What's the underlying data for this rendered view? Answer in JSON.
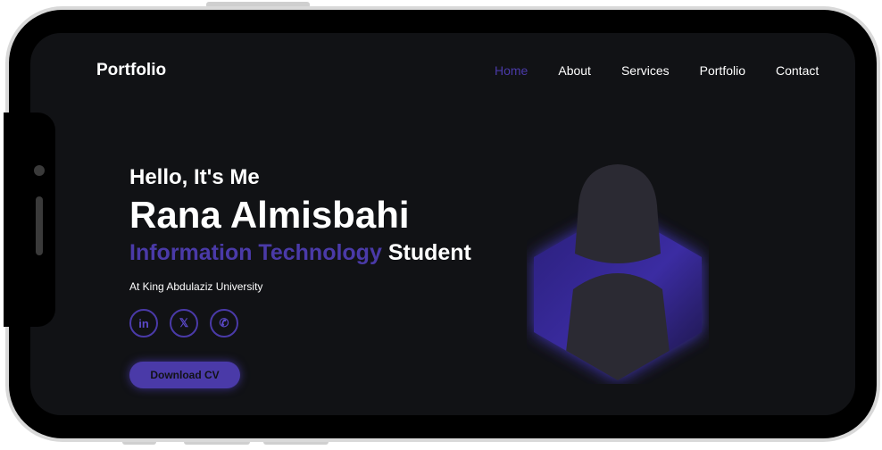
{
  "header": {
    "logo": "Portfolio",
    "nav": [
      {
        "label": "Home",
        "active": true
      },
      {
        "label": "About",
        "active": false
      },
      {
        "label": "Services",
        "active": false
      },
      {
        "label": "Portfolio",
        "active": false
      },
      {
        "label": "Contact",
        "active": false
      }
    ]
  },
  "hero": {
    "greeting": "Hello, It's Me",
    "name": "Rana Almisbahi",
    "role_accent": "Information Technology",
    "role_rest": "Student",
    "subtitle": "At King Abdulaziz University",
    "socials": [
      {
        "icon": "linkedin-icon",
        "glyph": "in"
      },
      {
        "icon": "x-twitter-icon",
        "glyph": "𝕏"
      },
      {
        "icon": "whatsapp-icon",
        "glyph": "✆"
      }
    ],
    "cta_label": "Download CV"
  },
  "colors": {
    "accent": "#4a3aa8",
    "background": "#111215",
    "text": "#ffffff"
  }
}
